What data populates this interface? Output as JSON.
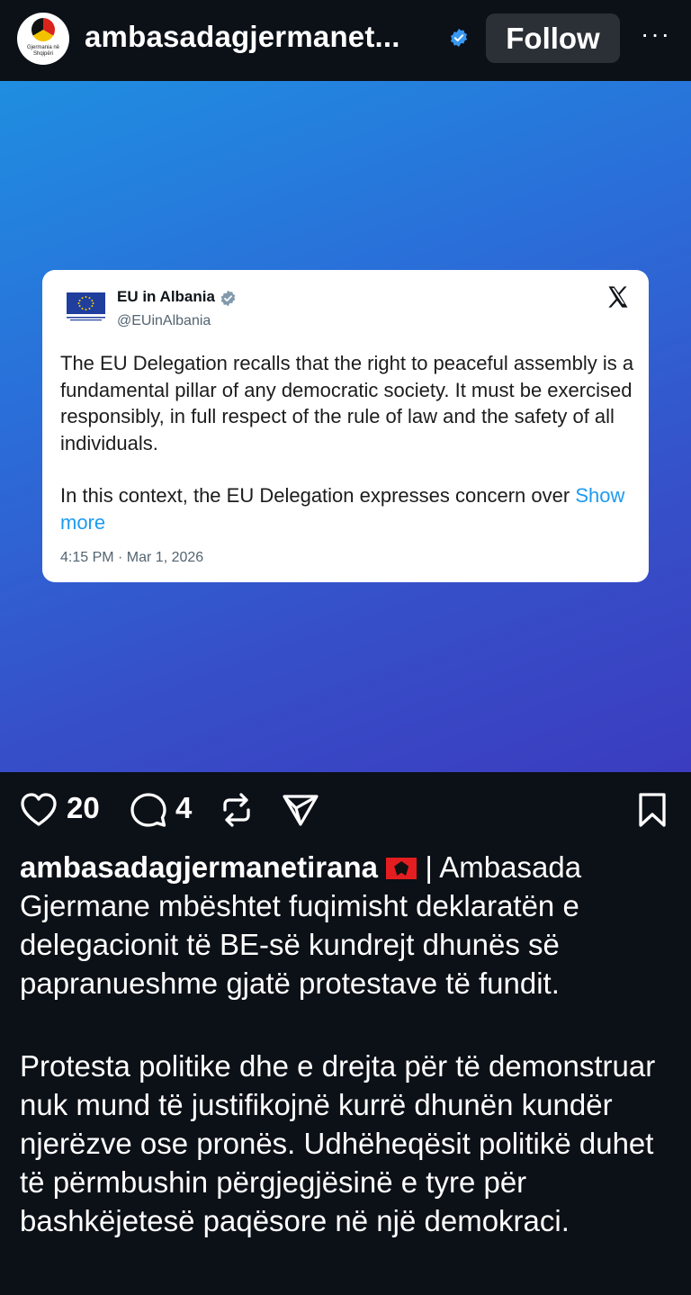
{
  "header": {
    "username": "ambasadagjermanet...",
    "avatar_text": "Gjermania në Shqipëri",
    "follow_label": "Follow",
    "more_label": "···"
  },
  "tweet": {
    "name": "EU in Albania",
    "handle": "@EUinAlbania",
    "flag_caption": "EUROPEAN UNION",
    "paragraph1": "The EU Delegation recalls that the right to peaceful assembly is a fundamental pillar of any democratic society. It must be exercised responsibly, in full respect of the rule of law and the safety of all individuals.",
    "paragraph2_prefix": "In this context, the EU Delegation expresses concern over ",
    "show_more": "Show more",
    "timestamp": "4:15 PM · Mar 1, 2026"
  },
  "actions": {
    "likes": "20",
    "comments": "4"
  },
  "caption": {
    "username": "ambasadagjermanetirana",
    "first_text": " | Ambasada Gjermane mbështet fuqimisht deklaratën e delegacionit të BE-së kundrejt dhunës së papranueshme gjatë protestave të fundit.",
    "second_paragraph": "Protesta politike dhe e drejta për të demonstruar nuk mund të justifikojnë kurrë dhunën kundër njerëzve ose pronës. Udhëheqësit politikë duhet të përmbushin përgjegjësinë e tyre për bashkëjetesë paqësore në një demokraci."
  },
  "colors": {
    "background": "#0c1017",
    "link": "#1d9bf0",
    "verified": "#3897f0"
  }
}
